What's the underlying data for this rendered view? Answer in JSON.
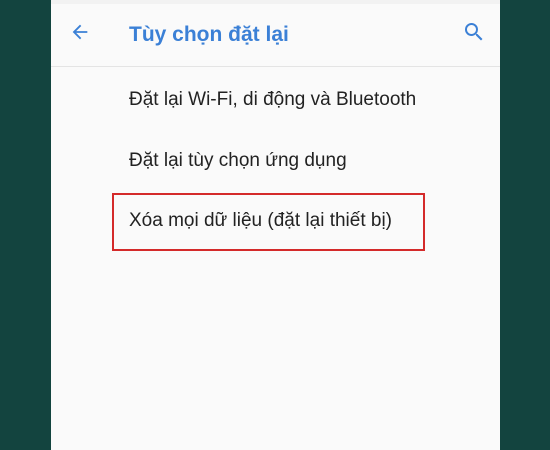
{
  "app_bar": {
    "title": "Tùy chọn đặt lại",
    "back_icon": "arrow-left-icon",
    "search_icon": "search-icon",
    "accent_color": "#3b80d6"
  },
  "options": [
    {
      "label": "Đặt lại Wi-Fi, di động và Bluetooth"
    },
    {
      "label": "Đặt lại tùy chọn ứng dụng"
    },
    {
      "label": "Xóa mọi dữ liệu (đặt lại thiết bị)",
      "highlighted": true
    }
  ],
  "highlight_color": "#d42a2a"
}
